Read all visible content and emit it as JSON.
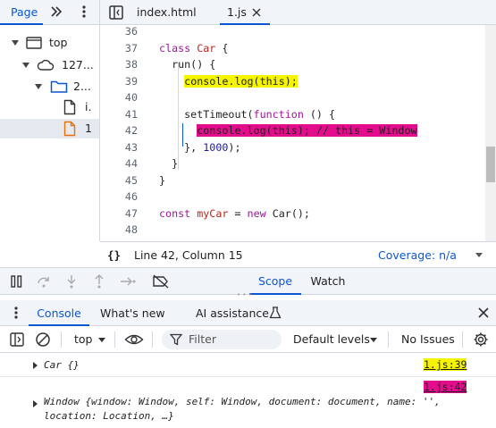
{
  "navigator": {
    "tab_label": "Page",
    "tree": [
      {
        "label": "top"
      },
      {
        "label": "127..."
      },
      {
        "label": "2..."
      },
      {
        "label": "i."
      },
      {
        "label": "1"
      }
    ]
  },
  "editor_tabs": [
    {
      "label": "index.html"
    },
    {
      "label": "1.js"
    }
  ],
  "code": {
    "line_numbers": [
      "36",
      "37",
      "38",
      "39",
      "40",
      "41",
      "42",
      "43",
      "44",
      "45",
      "46",
      "47",
      "48"
    ],
    "lines": [
      "",
      "class Car {",
      "  run() {",
      "    console.log(this);",
      "",
      "    setTimeout(function () {",
      "      console.log(this); // this = Window",
      "    }, 1000);",
      "  }",
      "}",
      "",
      "const myCar = new Car();",
      ""
    ]
  },
  "status": {
    "braces": "{}",
    "position": "Line 42, Column 15",
    "coverage": "Coverage: n/a"
  },
  "debugger": {
    "tabs": [
      "Scope",
      "Watch"
    ]
  },
  "drawer": {
    "tabs": [
      "Console",
      "What's new",
      "AI assistance"
    ]
  },
  "console_toolbar": {
    "context": "top",
    "filter_placeholder": "Filter",
    "levels": "Default levels",
    "issues": "No Issues"
  },
  "messages": [
    {
      "text": "Car {}",
      "source": "1.js:39",
      "highlight": "#f5f500"
    },
    {
      "text_line1": "Window {window: Window, self: Window, document: document, name: '',",
      "text_line2": "location: Location, …}",
      "source": "1.js:42",
      "highlight": "#e30c8c"
    }
  ],
  "colors": {
    "accent": "#0b57d0",
    "highlight_yellow": "#f5f500",
    "highlight_magenta": "#e30c8c"
  }
}
